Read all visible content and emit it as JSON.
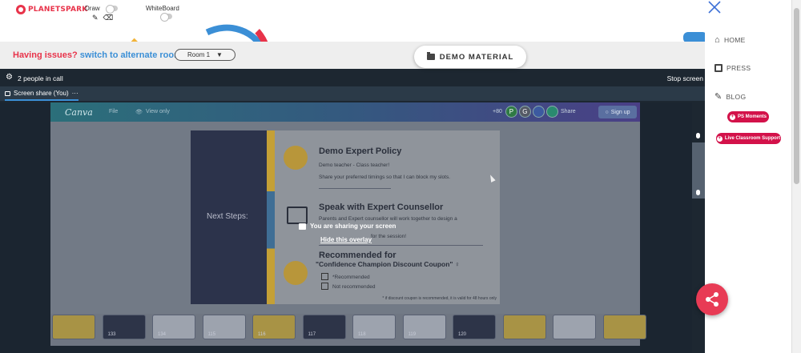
{
  "brand": {
    "logo_text": "PLANETSPARK"
  },
  "toolbar": {
    "draw_label": "Draw",
    "whiteboard_label": "WhiteBoard"
  },
  "issue_bar": {
    "prefix": "Having issues?",
    "link": "switch to alternate room",
    "room_select": "Room 1"
  },
  "demo_material": {
    "label": "DEMO MATERIAL"
  },
  "call": {
    "people_count": "2 people in call",
    "stop_label": "Stop screen",
    "share_tab": "Screen share (You)",
    "share_tab_more": "···"
  },
  "canva": {
    "logo": "Canva",
    "menu": [
      "File",
      "View only"
    ],
    "avatars": [
      {
        "letter": "P",
        "color": "#2f7a44"
      },
      {
        "letter": "G",
        "color": "#555a66"
      },
      {
        "letter": "",
        "color": "#3c5aa0"
      },
      {
        "letter": "",
        "color": "#2a8a6f"
      }
    ],
    "avatar_extra": "+80",
    "share_label": "Share",
    "signup_label": "Sign up"
  },
  "slide": {
    "left_title": "Next Steps:",
    "s1_title": "Demo Expert Policy",
    "s1_line1": "Demo teacher - Class teacher!",
    "s1_line2": "Share your preferred timings so that I can block my slots.",
    "s2_title": "Speak with Expert Counsellor",
    "s2_line1": "Parents and Expert counsellor will work together to design a",
    "s2_line2": "for the session!",
    "s3_title": "Recommended for",
    "s3_sub": "\"Confidence Champion Discount Coupon\" ♀",
    "opt1": "*Recommended",
    "opt2": "Not recommended",
    "note": "* if discount coupon is recommended, it is valid for 48 hours only"
  },
  "overlay": {
    "message": "You are sharing your screen",
    "hide_link": "Hide this overlay"
  },
  "thumbnails": [
    {
      "count": "",
      "style": "gold"
    },
    {
      "count": "133",
      "style": "dark"
    },
    {
      "count": "134",
      "style": "light"
    },
    {
      "count": "115",
      "style": "light"
    },
    {
      "count": "116",
      "style": "gold"
    },
    {
      "count": "117",
      "style": "dark"
    },
    {
      "count": "118",
      "style": "light"
    },
    {
      "count": "119",
      "style": "light"
    },
    {
      "count": "120",
      "style": "dark"
    },
    {
      "count": "",
      "style": "gold"
    },
    {
      "count": "",
      "style": "light"
    },
    {
      "count": "",
      "style": "gold"
    }
  ],
  "right_nav": {
    "items": [
      {
        "label": "HOME",
        "icon": "home-icon"
      },
      {
        "label": "PRESS",
        "icon": "newspaper-icon"
      },
      {
        "label": "BLOG",
        "icon": "pencil-icon"
      }
    ],
    "ps_moments": "PS Moments",
    "live_support": "Live Classroom Support"
  },
  "colors": {
    "brand_red": "#e8334a",
    "link_blue": "#3b8fd6",
    "pill_red": "#d3124a",
    "call_bg": "#1d2731"
  }
}
